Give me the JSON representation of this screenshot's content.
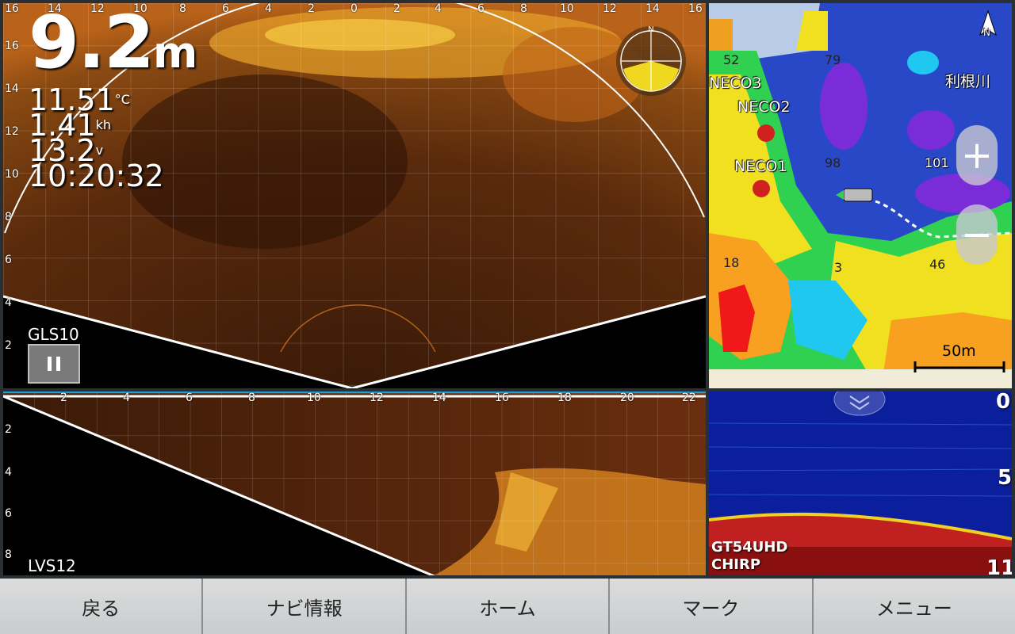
{
  "top_sonar": {
    "top_axis": [
      "16",
      "14",
      "12",
      "10",
      "8",
      "6",
      "4",
      "2",
      "0",
      "2",
      "4",
      "6",
      "8",
      "10",
      "12",
      "14",
      "16"
    ],
    "left_axis": [
      "16",
      "14",
      "12",
      "10",
      "8",
      "6",
      "4",
      "2"
    ],
    "depth_value": "9.2",
    "depth_unit": "m",
    "temperature": "11.51",
    "temperature_unit": "°C",
    "speed": "1.41",
    "speed_unit": "kh",
    "voltage": "13.2",
    "voltage_unit": "v",
    "time": "10:20:32",
    "transducer": "GLS10",
    "pause_icon": "pause-icon",
    "compass_north": "N"
  },
  "bottom_sonar": {
    "top_axis": [
      "2",
      "4",
      "6",
      "8",
      "10",
      "12",
      "14",
      "16",
      "18",
      "20",
      "22"
    ],
    "left_axis": [
      "2",
      "4",
      "6",
      "8"
    ],
    "transducer": "LVS12"
  },
  "map": {
    "north": "N",
    "waypoints": [
      "NECO3",
      "NECO2",
      "NECO1"
    ],
    "river_label": "利根川",
    "contour_labels": [
      "52",
      "79",
      "98",
      "101",
      "18",
      "3",
      "46"
    ],
    "scale": "50m",
    "zoom_in": "+",
    "zoom_out": "−",
    "colors": {
      "deep": "#2848c8",
      "purple": "#7a2cd8",
      "cyan": "#20c8f0",
      "green": "#30d050",
      "yellow": "#f0e020",
      "orange": "#f8a020",
      "red": "#f01818"
    }
  },
  "fishfinder": {
    "depth_top": "0",
    "depth_mid": "5",
    "depth_bottom": "11",
    "model": "GT54UHD",
    "mode": "CHIRP"
  },
  "bottom_bar": {
    "back": "戻る",
    "nav_info": "ナビ情報",
    "home": "ホーム",
    "mark": "マーク",
    "menu": "メニュー"
  }
}
